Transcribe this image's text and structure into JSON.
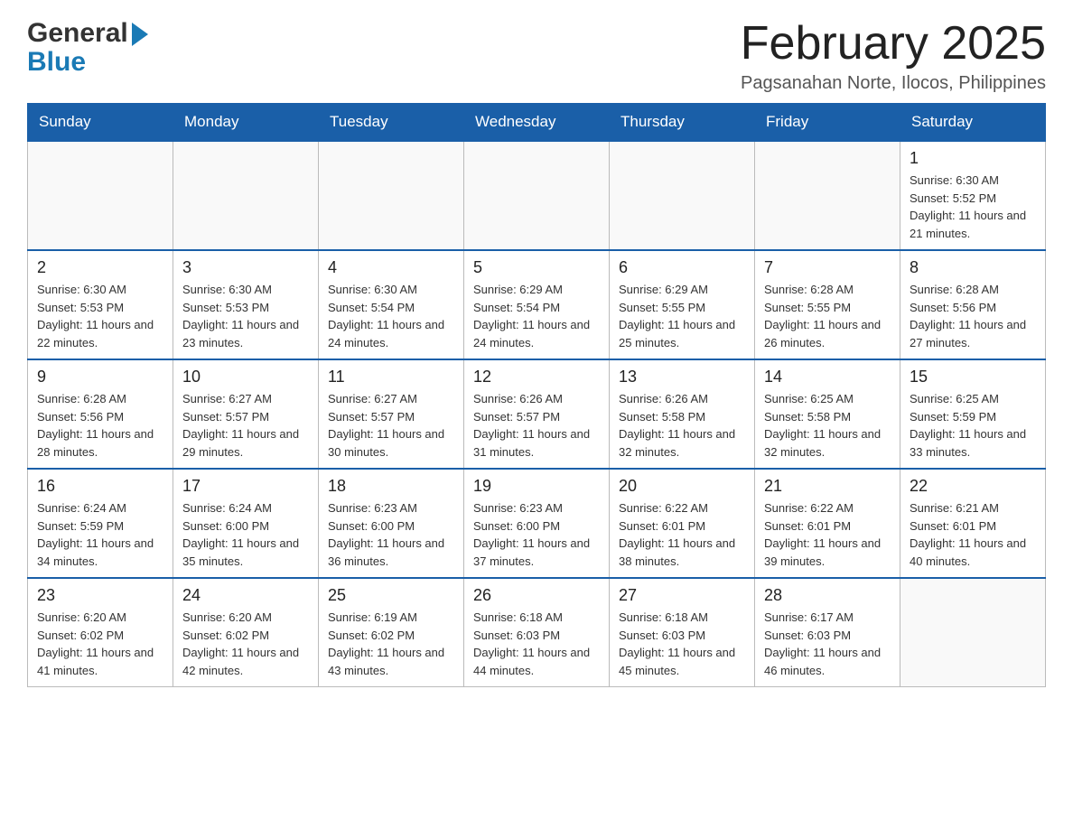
{
  "header": {
    "logo_general": "General",
    "logo_blue": "Blue",
    "main_title": "February 2025",
    "subtitle": "Pagsanahan Norte, Ilocos, Philippines"
  },
  "calendar": {
    "days": [
      "Sunday",
      "Monday",
      "Tuesday",
      "Wednesday",
      "Thursday",
      "Friday",
      "Saturday"
    ],
    "weeks": [
      [
        {
          "day": "",
          "info": ""
        },
        {
          "day": "",
          "info": ""
        },
        {
          "day": "",
          "info": ""
        },
        {
          "day": "",
          "info": ""
        },
        {
          "day": "",
          "info": ""
        },
        {
          "day": "",
          "info": ""
        },
        {
          "day": "1",
          "info": "Sunrise: 6:30 AM\nSunset: 5:52 PM\nDaylight: 11 hours and 21 minutes."
        }
      ],
      [
        {
          "day": "2",
          "info": "Sunrise: 6:30 AM\nSunset: 5:53 PM\nDaylight: 11 hours and 22 minutes."
        },
        {
          "day": "3",
          "info": "Sunrise: 6:30 AM\nSunset: 5:53 PM\nDaylight: 11 hours and 23 minutes."
        },
        {
          "day": "4",
          "info": "Sunrise: 6:30 AM\nSunset: 5:54 PM\nDaylight: 11 hours and 24 minutes."
        },
        {
          "day": "5",
          "info": "Sunrise: 6:29 AM\nSunset: 5:54 PM\nDaylight: 11 hours and 24 minutes."
        },
        {
          "day": "6",
          "info": "Sunrise: 6:29 AM\nSunset: 5:55 PM\nDaylight: 11 hours and 25 minutes."
        },
        {
          "day": "7",
          "info": "Sunrise: 6:28 AM\nSunset: 5:55 PM\nDaylight: 11 hours and 26 minutes."
        },
        {
          "day": "8",
          "info": "Sunrise: 6:28 AM\nSunset: 5:56 PM\nDaylight: 11 hours and 27 minutes."
        }
      ],
      [
        {
          "day": "9",
          "info": "Sunrise: 6:28 AM\nSunset: 5:56 PM\nDaylight: 11 hours and 28 minutes."
        },
        {
          "day": "10",
          "info": "Sunrise: 6:27 AM\nSunset: 5:57 PM\nDaylight: 11 hours and 29 minutes."
        },
        {
          "day": "11",
          "info": "Sunrise: 6:27 AM\nSunset: 5:57 PM\nDaylight: 11 hours and 30 minutes."
        },
        {
          "day": "12",
          "info": "Sunrise: 6:26 AM\nSunset: 5:57 PM\nDaylight: 11 hours and 31 minutes."
        },
        {
          "day": "13",
          "info": "Sunrise: 6:26 AM\nSunset: 5:58 PM\nDaylight: 11 hours and 32 minutes."
        },
        {
          "day": "14",
          "info": "Sunrise: 6:25 AM\nSunset: 5:58 PM\nDaylight: 11 hours and 32 minutes."
        },
        {
          "day": "15",
          "info": "Sunrise: 6:25 AM\nSunset: 5:59 PM\nDaylight: 11 hours and 33 minutes."
        }
      ],
      [
        {
          "day": "16",
          "info": "Sunrise: 6:24 AM\nSunset: 5:59 PM\nDaylight: 11 hours and 34 minutes."
        },
        {
          "day": "17",
          "info": "Sunrise: 6:24 AM\nSunset: 6:00 PM\nDaylight: 11 hours and 35 minutes."
        },
        {
          "day": "18",
          "info": "Sunrise: 6:23 AM\nSunset: 6:00 PM\nDaylight: 11 hours and 36 minutes."
        },
        {
          "day": "19",
          "info": "Sunrise: 6:23 AM\nSunset: 6:00 PM\nDaylight: 11 hours and 37 minutes."
        },
        {
          "day": "20",
          "info": "Sunrise: 6:22 AM\nSunset: 6:01 PM\nDaylight: 11 hours and 38 minutes."
        },
        {
          "day": "21",
          "info": "Sunrise: 6:22 AM\nSunset: 6:01 PM\nDaylight: 11 hours and 39 minutes."
        },
        {
          "day": "22",
          "info": "Sunrise: 6:21 AM\nSunset: 6:01 PM\nDaylight: 11 hours and 40 minutes."
        }
      ],
      [
        {
          "day": "23",
          "info": "Sunrise: 6:20 AM\nSunset: 6:02 PM\nDaylight: 11 hours and 41 minutes."
        },
        {
          "day": "24",
          "info": "Sunrise: 6:20 AM\nSunset: 6:02 PM\nDaylight: 11 hours and 42 minutes."
        },
        {
          "day": "25",
          "info": "Sunrise: 6:19 AM\nSunset: 6:02 PM\nDaylight: 11 hours and 43 minutes."
        },
        {
          "day": "26",
          "info": "Sunrise: 6:18 AM\nSunset: 6:03 PM\nDaylight: 11 hours and 44 minutes."
        },
        {
          "day": "27",
          "info": "Sunrise: 6:18 AM\nSunset: 6:03 PM\nDaylight: 11 hours and 45 minutes."
        },
        {
          "day": "28",
          "info": "Sunrise: 6:17 AM\nSunset: 6:03 PM\nDaylight: 11 hours and 46 minutes."
        },
        {
          "day": "",
          "info": ""
        }
      ]
    ]
  }
}
